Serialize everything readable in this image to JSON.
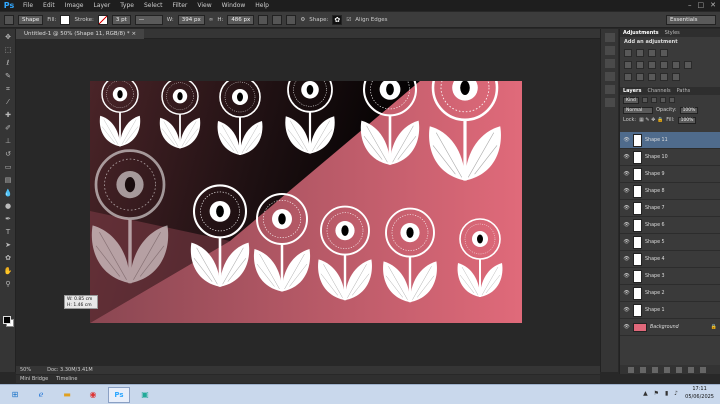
{
  "app": {
    "logo": "Ps"
  },
  "menu": [
    "File",
    "Edit",
    "Image",
    "Layer",
    "Type",
    "Select",
    "Filter",
    "View",
    "Window",
    "Help"
  ],
  "options": {
    "tool_mode": "Shape",
    "fill_label": "Fill:",
    "stroke_label": "Stroke:",
    "stroke_width": "3 pt",
    "w_label": "W:",
    "w_value": "394 px",
    "h_label": "H:",
    "h_value": "486 px",
    "shape_label": "Shape:",
    "align_edges": "Align Edges",
    "workspace": "Essentials"
  },
  "document": {
    "tab_title": "Untitled-1 @ 50% (Shape 11, RGB/8) *",
    "zoom": "50%",
    "doc_size": "Doc: 3.30M/3.41M"
  },
  "tooltip": {
    "w": "W: 0.85 cm",
    "h": "H: 1.46 cm"
  },
  "bottom_tabs": [
    "Mini Bridge",
    "Timeline"
  ],
  "adjustments": {
    "tabs": [
      "Adjustments",
      "Styles"
    ],
    "title": "Add an adjustment"
  },
  "layers_panel": {
    "tabs": [
      "Layers",
      "Channels",
      "Paths"
    ],
    "kind": "Kind",
    "blend_mode": "Normal",
    "opacity_label": "Opacity:",
    "opacity_value": "100%",
    "lock_label": "Lock:",
    "fill_label": "Fill:",
    "fill_value": "100%",
    "layers": [
      "Shape 11",
      "Shape 10",
      "Shape 9",
      "Shape 8",
      "Shape 7",
      "Shape 6",
      "Shape 5",
      "Shape 4",
      "Shape 3",
      "Shape 2",
      "Shape 1",
      "Background"
    ]
  },
  "clock": {
    "time": "17:11",
    "date": "05/06/2025"
  },
  "colors": {
    "pink": "#e06a7a",
    "dark_maroon": "#3a1a1e",
    "black": "#050505",
    "selected_layer": "#4f6b8c"
  }
}
